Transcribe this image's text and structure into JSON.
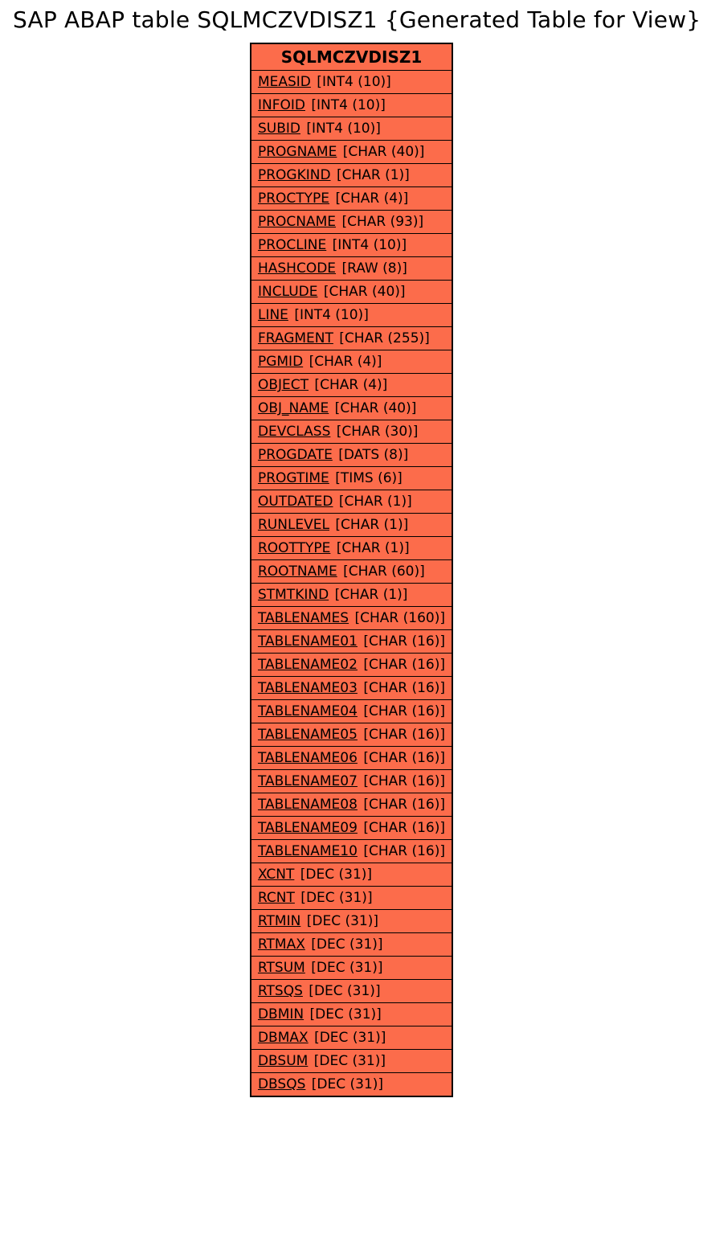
{
  "title": "SAP ABAP table SQLMCZVDISZ1 {Generated Table for View}",
  "table": {
    "name": "SQLMCZVDISZ1",
    "fields": [
      {
        "name": "MEASID",
        "type": "[INT4 (10)]"
      },
      {
        "name": "INFOID",
        "type": "[INT4 (10)]"
      },
      {
        "name": "SUBID",
        "type": "[INT4 (10)]"
      },
      {
        "name": "PROGNAME",
        "type": "[CHAR (40)]"
      },
      {
        "name": "PROGKIND",
        "type": "[CHAR (1)]"
      },
      {
        "name": "PROCTYPE",
        "type": "[CHAR (4)]"
      },
      {
        "name": "PROCNAME",
        "type": "[CHAR (93)]"
      },
      {
        "name": "PROCLINE",
        "type": "[INT4 (10)]"
      },
      {
        "name": "HASHCODE",
        "type": "[RAW (8)]"
      },
      {
        "name": "INCLUDE",
        "type": "[CHAR (40)]"
      },
      {
        "name": "LINE",
        "type": "[INT4 (10)]"
      },
      {
        "name": "FRAGMENT",
        "type": "[CHAR (255)]"
      },
      {
        "name": "PGMID",
        "type": "[CHAR (4)]"
      },
      {
        "name": "OBJECT",
        "type": "[CHAR (4)]"
      },
      {
        "name": "OBJ_NAME",
        "type": "[CHAR (40)]"
      },
      {
        "name": "DEVCLASS",
        "type": "[CHAR (30)]"
      },
      {
        "name": "PROGDATE",
        "type": "[DATS (8)]"
      },
      {
        "name": "PROGTIME",
        "type": "[TIMS (6)]"
      },
      {
        "name": "OUTDATED",
        "type": "[CHAR (1)]"
      },
      {
        "name": "RUNLEVEL",
        "type": "[CHAR (1)]"
      },
      {
        "name": "ROOTTYPE",
        "type": "[CHAR (1)]"
      },
      {
        "name": "ROOTNAME",
        "type": "[CHAR (60)]"
      },
      {
        "name": "STMTKIND",
        "type": "[CHAR (1)]"
      },
      {
        "name": "TABLENAMES",
        "type": "[CHAR (160)]"
      },
      {
        "name": "TABLENAME01",
        "type": "[CHAR (16)]"
      },
      {
        "name": "TABLENAME02",
        "type": "[CHAR (16)]"
      },
      {
        "name": "TABLENAME03",
        "type": "[CHAR (16)]"
      },
      {
        "name": "TABLENAME04",
        "type": "[CHAR (16)]"
      },
      {
        "name": "TABLENAME05",
        "type": "[CHAR (16)]"
      },
      {
        "name": "TABLENAME06",
        "type": "[CHAR (16)]"
      },
      {
        "name": "TABLENAME07",
        "type": "[CHAR (16)]"
      },
      {
        "name": "TABLENAME08",
        "type": "[CHAR (16)]"
      },
      {
        "name": "TABLENAME09",
        "type": "[CHAR (16)]"
      },
      {
        "name": "TABLENAME10",
        "type": "[CHAR (16)]"
      },
      {
        "name": "XCNT",
        "type": "[DEC (31)]"
      },
      {
        "name": "RCNT",
        "type": "[DEC (31)]"
      },
      {
        "name": "RTMIN",
        "type": "[DEC (31)]"
      },
      {
        "name": "RTMAX",
        "type": "[DEC (31)]"
      },
      {
        "name": "RTSUM",
        "type": "[DEC (31)]"
      },
      {
        "name": "RTSQS",
        "type": "[DEC (31)]"
      },
      {
        "name": "DBMIN",
        "type": "[DEC (31)]"
      },
      {
        "name": "DBMAX",
        "type": "[DEC (31)]"
      },
      {
        "name": "DBSUM",
        "type": "[DEC (31)]"
      },
      {
        "name": "DBSQS",
        "type": "[DEC (31)]"
      }
    ]
  }
}
